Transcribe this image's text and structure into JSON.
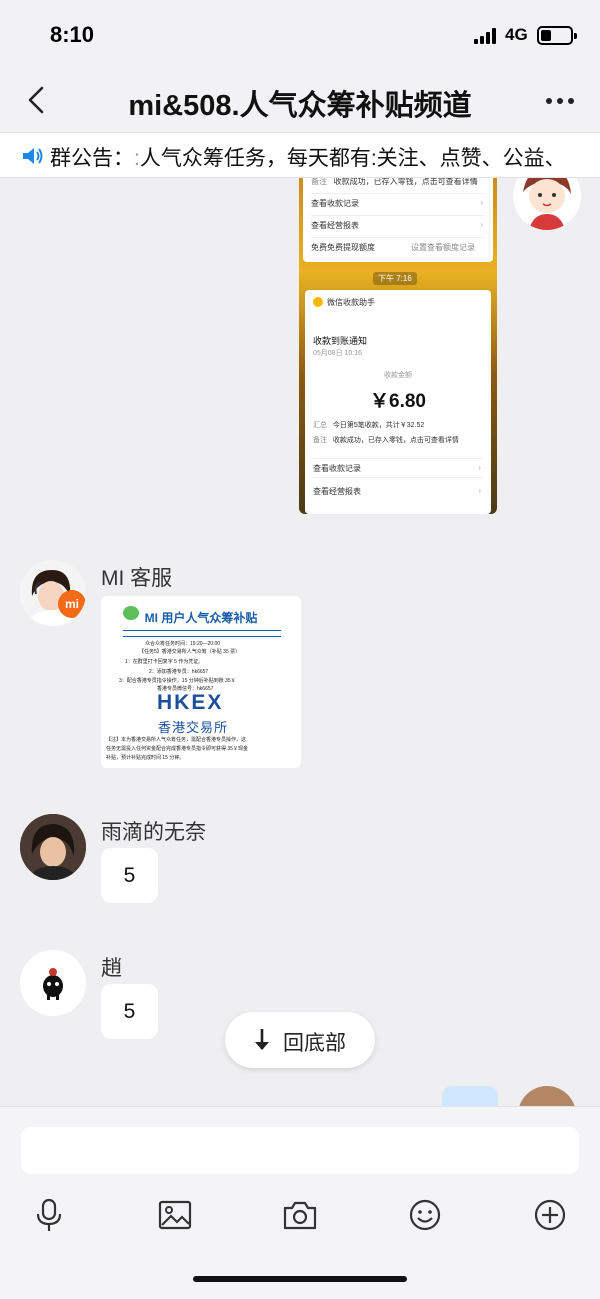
{
  "status_bar": {
    "time": "8:10",
    "network": "4G"
  },
  "nav": {
    "title": "mi&508.人气众筹补贴频道",
    "back_icon": "chevron-left-icon",
    "more_icon": "more-dots-icon"
  },
  "notice": {
    "label": "群公告：",
    "text": "人气众筹任务，每天都有:关注、点赞、公益、",
    "icon": "speaker-icon"
  },
  "screenshot": {
    "top_rows": [
      {
        "label": "备注",
        "value": "收款成功，已存入零钱，点击可查看详情"
      },
      {
        "label": "查看收款记录"
      },
      {
        "label": "查看经营报表"
      },
      {
        "label": "免费免费提现额度",
        "value": "设置查看额度记录"
      }
    ],
    "time": "下午 7:16",
    "app": "微信收款助手",
    "notice_title": "收款到账通知",
    "notice_date": "05月08日 10:16",
    "amount_label": "收款金额",
    "amount": "￥6.80",
    "summary_label": "汇总",
    "summary": "今日第5笔收款，共计￥32.52",
    "note_label": "备注",
    "note": "收款成功，已存入零钱，点击可查看详情",
    "bottom_rows": [
      "查看收款记录",
      "查看经营报表"
    ]
  },
  "messages": [
    {
      "sender": "MI 客服",
      "poster": {
        "title": "MI 用户人气众筹补贴",
        "lines": [
          "众合众筹任务时间：19:20—20:00",
          "【任务5】香港交易所人气众筹（补贴 35 票）",
          "1：在群里打卡回复字 5 作为凭证。",
          "2：添加香港专员：hk6657",
          "3：配合香港专员指令操作，15 分钟后补贴到账 35￥",
          "香港专员微信号：hk6657"
        ],
        "hkex": "HKEX",
        "hkex_cn": "香港交易所",
        "footer": [
          "【注】本为香港交易所人气众筹任务，需配合香港专员操作，这",
          "任务无需投入任何资金配合完成香港专员指令即可获得 35￥现金",
          "补贴，预计补贴完成时间 15 分钟。"
        ]
      }
    },
    {
      "sender": "雨滴的无奈",
      "text": "5"
    },
    {
      "sender": "趙",
      "text": "5"
    }
  ],
  "scroll_to_bottom": {
    "label": "回底部",
    "icon": "arrow-down-icon"
  },
  "toolbar": {
    "input_placeholder": "",
    "icons": [
      "microphone-icon",
      "image-icon",
      "camera-icon",
      "emoji-icon",
      "plus-circle-icon"
    ]
  },
  "colors": {
    "accent_blue": "#1a5ea8",
    "mi_orange": "#f46b17",
    "hkex_blue": "#1b4f9c"
  }
}
